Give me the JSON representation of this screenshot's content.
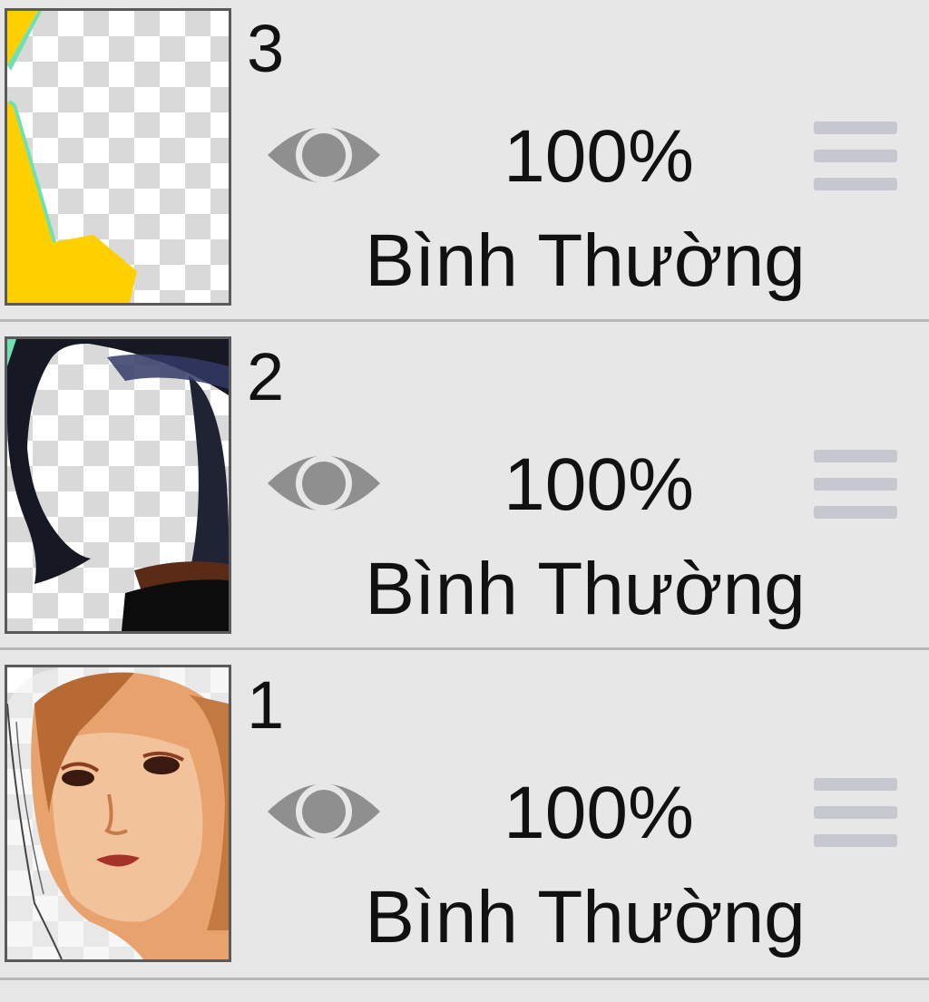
{
  "layers": [
    {
      "number": "3",
      "opacity": "100%",
      "blend_mode": "Bình Thường",
      "thumbnail": "yellow-green-shape",
      "visibility_icon": "eye-icon",
      "handle_icon": "drag-handle-icon"
    },
    {
      "number": "2",
      "opacity": "100%",
      "blend_mode": "Bình Thường",
      "thumbnail": "dark-hair-strands",
      "visibility_icon": "eye-icon",
      "handle_icon": "drag-handle-icon"
    },
    {
      "number": "1",
      "opacity": "100%",
      "blend_mode": "Bình Thường",
      "thumbnail": "face-portrait",
      "visibility_icon": "eye-icon",
      "handle_icon": "drag-handle-icon"
    }
  ],
  "colors": {
    "background": "#e7e7e7",
    "divider": "#b7b7b7",
    "eye": "#8f8f8f",
    "handle": "#c7c7cf",
    "yellow_shape": "#ffd000",
    "green_edge": "#6fe0b0"
  }
}
